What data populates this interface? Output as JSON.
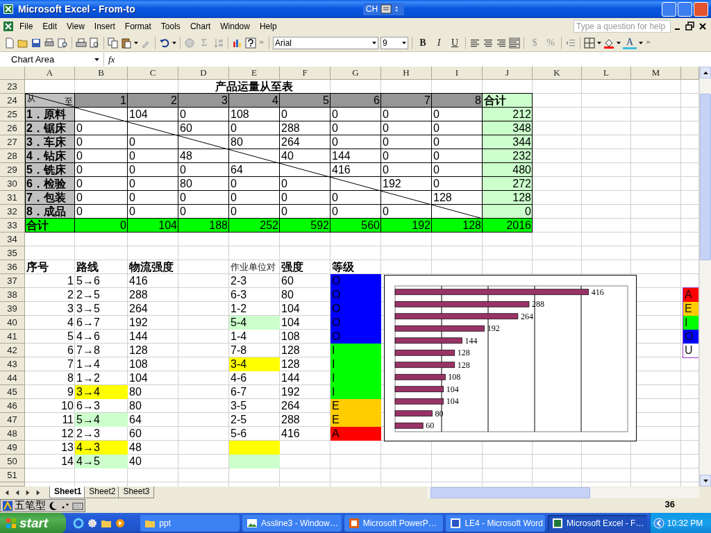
{
  "window": {
    "title": "Microsoft Excel - From-to",
    "language": "CH"
  },
  "menu": [
    "File",
    "Edit",
    "View",
    "Insert",
    "Format",
    "Tools",
    "Chart",
    "Window",
    "Help"
  ],
  "help_box": {
    "placeholder": "Type a question for help"
  },
  "toolbar": {
    "sigma": "Σ",
    "font": "Arial",
    "size": "9",
    "format_buttons": [
      "B",
      "I",
      "U"
    ],
    "number_buttons": [
      "$",
      "%"
    ],
    "font_color": "A"
  },
  "formula_bar": {
    "name_box": "Chart Area",
    "fx": "fx"
  },
  "sheet": {
    "columns": [
      "A",
      "B",
      "C",
      "D",
      "E",
      "F",
      "G",
      "H",
      "I",
      "J",
      "K",
      "L",
      "M"
    ],
    "rows": [
      {
        "number": "23",
        "boxed": false,
        "cells": [
          {
            "text": "产品运量从至表",
            "kind": "title"
          }
        ]
      },
      {
        "number": "24",
        "boxed": true,
        "cells": [
          {
            "kind": "corner",
            "from": "从",
            "to": "至",
            "color": "#c0c0c0"
          },
          {
            "text": "1",
            "kind": "num",
            "color": "#969696"
          },
          {
            "text": "2",
            "kind": "num",
            "color": "#969696"
          },
          {
            "text": "3",
            "kind": "num",
            "color": "#969696"
          },
          {
            "text": "4",
            "kind": "num",
            "color": "#969696"
          },
          {
            "text": "5",
            "kind": "num",
            "color": "#969696"
          },
          {
            "text": "6",
            "kind": "num",
            "color": "#969696"
          },
          {
            "text": "7",
            "kind": "num",
            "color": "#969696"
          },
          {
            "text": "8",
            "kind": "num",
            "color": "#969696"
          },
          {
            "text": "合计",
            "kind": "head",
            "color": "#ccffcc"
          }
        ]
      },
      {
        "number": "25",
        "boxed": true,
        "cells": [
          {
            "text": "1．原料",
            "kind": "head",
            "color": "#c0c0c0"
          },
          {},
          {
            "text": "104",
            "kind": "text"
          },
          {
            "text": "0",
            "kind": "text"
          },
          {
            "text": "108",
            "kind": "text"
          },
          {
            "text": "0",
            "kind": "text"
          },
          {
            "text": "0",
            "kind": "text"
          },
          {
            "text": "0",
            "kind": "text"
          },
          {
            "text": "0",
            "kind": "text"
          },
          {
            "text": "212",
            "kind": "num",
            "color": "#ccffcc"
          }
        ]
      },
      {
        "number": "26",
        "boxed": true,
        "cells": [
          {
            "text": "2．锯床",
            "kind": "head",
            "color": "#c0c0c0"
          },
          {
            "text": "0",
            "kind": "text"
          },
          {},
          {
            "text": "60",
            "kind": "text"
          },
          {
            "text": "0",
            "kind": "text"
          },
          {
            "text": "288",
            "kind": "text"
          },
          {
            "text": "0",
            "kind": "text"
          },
          {
            "text": "0",
            "kind": "text"
          },
          {
            "text": "0",
            "kind": "text"
          },
          {
            "text": "348",
            "kind": "num",
            "color": "#ccffcc"
          }
        ]
      },
      {
        "number": "27",
        "boxed": true,
        "cells": [
          {
            "text": "3．车床",
            "kind": "head",
            "color": "#c0c0c0"
          },
          {
            "text": "0",
            "kind": "text"
          },
          {
            "text": "0",
            "kind": "text"
          },
          {},
          {
            "text": "80",
            "kind": "text"
          },
          {
            "text": "264",
            "kind": "text"
          },
          {
            "text": "0",
            "kind": "text"
          },
          {
            "text": "0",
            "kind": "text"
          },
          {
            "text": "0",
            "kind": "text"
          },
          {
            "text": "344",
            "kind": "num",
            "color": "#ccffcc"
          }
        ]
      },
      {
        "number": "28",
        "boxed": true,
        "cells": [
          {
            "text": "4．钻床",
            "kind": "head",
            "color": "#c0c0c0"
          },
          {
            "text": "0",
            "kind": "text"
          },
          {
            "text": "0",
            "kind": "text"
          },
          {
            "text": "48",
            "kind": "text"
          },
          {},
          {
            "text": "40",
            "kind": "text"
          },
          {
            "text": "144",
            "kind": "text"
          },
          {
            "text": "0",
            "kind": "text"
          },
          {
            "text": "0",
            "kind": "text"
          },
          {
            "text": "232",
            "kind": "num",
            "color": "#ccffcc"
          }
        ]
      },
      {
        "number": "29",
        "boxed": true,
        "cells": [
          {
            "text": "5．铣床",
            "kind": "head",
            "color": "#c0c0c0"
          },
          {
            "text": "0",
            "kind": "text"
          },
          {
            "text": "0",
            "kind": "text"
          },
          {
            "text": "0",
            "kind": "text"
          },
          {
            "text": "64",
            "kind": "text"
          },
          {},
          {
            "text": "416",
            "kind": "text"
          },
          {
            "text": "0",
            "kind": "text"
          },
          {
            "text": "0",
            "kind": "text"
          },
          {
            "text": "480",
            "kind": "num",
            "color": "#ccffcc"
          }
        ]
      },
      {
        "number": "30",
        "boxed": true,
        "cells": [
          {
            "text": "6．检验",
            "kind": "head",
            "color": "#c0c0c0"
          },
          {
            "text": "0",
            "kind": "text"
          },
          {
            "text": "0",
            "kind": "text"
          },
          {
            "text": "80",
            "kind": "text"
          },
          {
            "text": "0",
            "kind": "text"
          },
          {
            "text": "0",
            "kind": "text"
          },
          {},
          {
            "text": "192",
            "kind": "text"
          },
          {
            "text": "0",
            "kind": "text"
          },
          {
            "text": "272",
            "kind": "num",
            "color": "#ccffcc"
          }
        ]
      },
      {
        "number": "31",
        "boxed": true,
        "cells": [
          {
            "text": "7．包装",
            "kind": "head",
            "color": "#c0c0c0"
          },
          {
            "text": "0",
            "kind": "text"
          },
          {
            "text": "0",
            "kind": "text"
          },
          {
            "text": "0",
            "kind": "text"
          },
          {
            "text": "0",
            "kind": "text"
          },
          {
            "text": "0",
            "kind": "text"
          },
          {
            "text": "0",
            "kind": "text"
          },
          {},
          {
            "text": "128",
            "kind": "text"
          },
          {
            "text": "128",
            "kind": "num",
            "color": "#ccffcc"
          }
        ]
      },
      {
        "number": "32",
        "boxed": true,
        "cells": [
          {
            "text": "8．成品",
            "kind": "head",
            "color": "#c0c0c0"
          },
          {
            "text": "0",
            "kind": "text"
          },
          {
            "text": "0",
            "kind": "text"
          },
          {
            "text": "0",
            "kind": "text"
          },
          {
            "text": "0",
            "kind": "text"
          },
          {
            "text": "0",
            "kind": "text"
          },
          {
            "text": "0",
            "kind": "text"
          },
          {
            "text": "0",
            "kind": "text"
          },
          {},
          {
            "text": "0",
            "kind": "num",
            "color": "#ccffcc"
          }
        ]
      },
      {
        "number": "33",
        "boxed": true,
        "cells": [
          {
            "text": "合计",
            "kind": "head",
            "color": "#00ff00"
          },
          {
            "text": "0",
            "kind": "num",
            "color": "#00ff00"
          },
          {
            "text": "104",
            "kind": "num",
            "color": "#00ff00"
          },
          {
            "text": "188",
            "kind": "num",
            "color": "#00ff00"
          },
          {
            "text": "252",
            "kind": "num",
            "color": "#00ff00"
          },
          {
            "text": "592",
            "kind": "num",
            "color": "#00ff00"
          },
          {
            "text": "560",
            "kind": "num",
            "color": "#00ff00"
          },
          {
            "text": "192",
            "kind": "num",
            "color": "#00ff00"
          },
          {
            "text": "128",
            "kind": "num",
            "color": "#00ff00"
          },
          {
            "text": "2016",
            "kind": "num",
            "color": "#00ff00"
          }
        ]
      },
      {
        "number": "34",
        "boxed": false
      },
      {
        "number": "35",
        "boxed": false
      },
      {
        "number": "36",
        "boxed": false,
        "cells": [
          {
            "text": "序号",
            "kind": "head"
          },
          {
            "text": "路线",
            "kind": "head"
          },
          {
            "text": "物流强度",
            "kind": "head"
          },
          {},
          {
            "text": "作业单位对",
            "kind": "small"
          },
          {
            "text": "强度",
            "kind": "head"
          },
          {
            "text": "等级",
            "kind": "head"
          }
        ]
      },
      {
        "number": "37",
        "boxed": false,
        "cells": [
          {
            "text": "1",
            "kind": "num"
          },
          {
            "text": "5→6",
            "kind": "text"
          },
          {
            "text": "416",
            "kind": "text"
          },
          {},
          {
            "text": "2-3",
            "kind": "text"
          },
          {
            "text": "60",
            "kind": "text"
          },
          {
            "text": "O",
            "kind": "text",
            "color": "#0000ff"
          }
        ]
      },
      {
        "number": "38",
        "boxed": false,
        "cells": [
          {
            "text": "2",
            "kind": "num"
          },
          {
            "text": "2→5",
            "kind": "text"
          },
          {
            "text": "288",
            "kind": "text"
          },
          {},
          {
            "text": "6-3",
            "kind": "text"
          },
          {
            "text": "80",
            "kind": "text"
          },
          {
            "text": "O",
            "kind": "text",
            "color": "#0000ff"
          }
        ]
      },
      {
        "number": "39",
        "boxed": false,
        "cells": [
          {
            "text": "3",
            "kind": "num"
          },
          {
            "text": "3→5",
            "kind": "text"
          },
          {
            "text": "264",
            "kind": "text"
          },
          {},
          {
            "text": "1-2",
            "kind": "text"
          },
          {
            "text": "104",
            "kind": "text"
          },
          {
            "text": "O",
            "kind": "text",
            "color": "#0000ff"
          }
        ]
      },
      {
        "number": "40",
        "boxed": false,
        "cells": [
          {
            "text": "4",
            "kind": "num"
          },
          {
            "text": "6→7",
            "kind": "text"
          },
          {
            "text": "192",
            "kind": "text"
          },
          {},
          {
            "text": "5-4",
            "kind": "text",
            "color": "#ccffcc"
          },
          {
            "text": "104",
            "kind": "text"
          },
          {
            "text": "O",
            "kind": "text",
            "color": "#0000ff"
          }
        ]
      },
      {
        "number": "41",
        "boxed": false,
        "cells": [
          {
            "text": "5",
            "kind": "num"
          },
          {
            "text": "4→6",
            "kind": "text"
          },
          {
            "text": "144",
            "kind": "text"
          },
          {},
          {
            "text": "1-4",
            "kind": "text"
          },
          {
            "text": "108",
            "kind": "text"
          },
          {
            "text": "O",
            "kind": "text",
            "color": "#0000ff"
          }
        ]
      },
      {
        "number": "42",
        "boxed": false,
        "cells": [
          {
            "text": "6",
            "kind": "num"
          },
          {
            "text": "7→8",
            "kind": "text"
          },
          {
            "text": "128",
            "kind": "text"
          },
          {},
          {
            "text": "7-8",
            "kind": "text"
          },
          {
            "text": "128",
            "kind": "text"
          },
          {
            "text": "I",
            "kind": "text",
            "color": "#00ff00"
          }
        ]
      },
      {
        "number": "43",
        "boxed": false,
        "cells": [
          {
            "text": "7",
            "kind": "num"
          },
          {
            "text": "1→4",
            "kind": "text"
          },
          {
            "text": "108",
            "kind": "text"
          },
          {},
          {
            "text": "3-4",
            "kind": "text",
            "color": "#ffff00"
          },
          {
            "text": "128",
            "kind": "text"
          },
          {
            "text": "I",
            "kind": "text",
            "color": "#00ff00"
          }
        ]
      },
      {
        "number": "44",
        "boxed": false,
        "cells": [
          {
            "text": "8",
            "kind": "num"
          },
          {
            "text": "1→2",
            "kind": "text"
          },
          {
            "text": "104",
            "kind": "text"
          },
          {},
          {
            "text": "4-6",
            "kind": "text"
          },
          {
            "text": "144",
            "kind": "text"
          },
          {
            "text": "I",
            "kind": "text",
            "color": "#00ff00"
          }
        ]
      },
      {
        "number": "45",
        "boxed": false,
        "cells": [
          {
            "text": "9",
            "kind": "num"
          },
          {
            "text": "3→4",
            "kind": "text",
            "color": "#ffff00"
          },
          {
            "text": "80",
            "kind": "text"
          },
          {},
          {
            "text": "6-7",
            "kind": "text"
          },
          {
            "text": "192",
            "kind": "text"
          },
          {
            "text": "I",
            "kind": "text",
            "color": "#00ff00"
          }
        ]
      },
      {
        "number": "46",
        "boxed": false,
        "cells": [
          {
            "text": "10",
            "kind": "num"
          },
          {
            "text": "6→3",
            "kind": "text"
          },
          {
            "text": "80",
            "kind": "text"
          },
          {},
          {
            "text": "3-5",
            "kind": "text"
          },
          {
            "text": "264",
            "kind": "text"
          },
          {
            "text": "E",
            "kind": "text",
            "color": "#ffcc00"
          }
        ]
      },
      {
        "number": "47",
        "boxed": false,
        "cells": [
          {
            "text": "11",
            "kind": "num"
          },
          {
            "text": "5→4",
            "kind": "text",
            "color": "#ccffcc"
          },
          {
            "text": "64",
            "kind": "text"
          },
          {},
          {
            "text": "2-5",
            "kind": "text"
          },
          {
            "text": "288",
            "kind": "text"
          },
          {
            "text": "E",
            "kind": "text",
            "color": "#ffcc00"
          }
        ]
      },
      {
        "number": "48",
        "boxed": false,
        "cells": [
          {
            "text": "12",
            "kind": "num"
          },
          {
            "text": "2→3",
            "kind": "text"
          },
          {
            "text": "60",
            "kind": "text"
          },
          {},
          {
            "text": "5-6",
            "kind": "text"
          },
          {
            "text": "416",
            "kind": "text"
          },
          {
            "text": "A",
            "kind": "text",
            "color": "#ff0000"
          }
        ]
      },
      {
        "number": "49",
        "boxed": false,
        "cells": [
          {
            "text": "13",
            "kind": "num"
          },
          {
            "text": "4→3",
            "kind": "text",
            "color": "#ffff00"
          },
          {
            "text": "48",
            "kind": "text"
          },
          {},
          {
            "color": "#ffff00"
          }
        ]
      },
      {
        "number": "50",
        "boxed": false,
        "cells": [
          {
            "text": "14",
            "kind": "num"
          },
          {
            "text": "4→5",
            "kind": "text",
            "color": "#ccffcc"
          },
          {
            "text": "40",
            "kind": "text"
          },
          {},
          {
            "color": "#ccffcc"
          }
        ]
      },
      {
        "number": "51",
        "boxed": false
      }
    ]
  },
  "chart": {
    "chart_data": {
      "type": "bar",
      "orientation": "horizontal",
      "xlim": [
        0,
        500
      ],
      "data_labels": true,
      "series": [
        {
          "color": "#993366",
          "values": [
            416,
            288,
            264,
            192,
            144,
            128,
            128,
            108,
            104,
            104,
            80,
            60
          ]
        }
      ]
    }
  },
  "legend": [
    {
      "text": "A",
      "color": "#ff0000"
    },
    {
      "text": "E",
      "color": "#ffcc00"
    },
    {
      "text": "I",
      "color": "#00ff00"
    },
    {
      "text": "O",
      "color": "#0000ff"
    },
    {
      "text": "U",
      "color": "#ffffff"
    }
  ],
  "sheet_tabs": [
    {
      "label": "Sheet1",
      "selected": true
    },
    {
      "label": "Sheet2",
      "selected": false
    },
    {
      "label": "Sheet3",
      "selected": false
    }
  ],
  "ime_bar": {
    "label": "五笔型"
  },
  "taskbar": {
    "start": "start",
    "tasks": [
      {
        "label": "ppt",
        "kind": "folder",
        "selected": false
      },
      {
        "label": "Assline3 - Window…",
        "kind": "image",
        "selected": false
      },
      {
        "label": "Microsoft PowerP…",
        "kind": "powerpoint",
        "selected": false
      },
      {
        "label": "LE4 - Microsoft Word",
        "kind": "word",
        "selected": false
      },
      {
        "label": "Microsoft Excel - F…",
        "kind": "excel",
        "selected": true
      }
    ],
    "tray_count": "36",
    "clock": "10:32 PM"
  }
}
